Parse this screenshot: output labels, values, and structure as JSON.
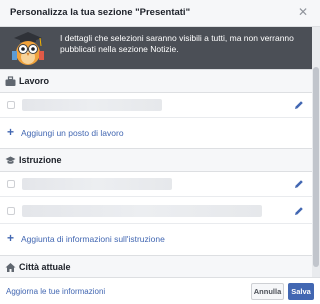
{
  "dialog": {
    "title": "Personalizza la tua sezione \"Presentati\"",
    "close_icon": "close-icon"
  },
  "banner": {
    "icon": "owl-mascot-icon",
    "text": "I dettagli che selezioni saranno visibili a tutti, ma non verranno pubblicati nella sezione Notizie."
  },
  "sections": {
    "work": {
      "icon": "briefcase-icon",
      "label": "Lavoro",
      "add_link": "Aggiungi un posto di lavoro"
    },
    "education": {
      "icon": "graduation-cap-icon",
      "label": "Istruzione",
      "add_link": "Aggiunta di informazioni sull'istruzione"
    },
    "city": {
      "icon": "home-icon",
      "label": "Città attuale"
    }
  },
  "footer": {
    "update_link": "Aggiorna le tue informazioni",
    "cancel_label": "Annulla",
    "save_label": "Salva"
  },
  "colors": {
    "accent": "#4267b2",
    "banner_bg": "#4b4f56",
    "header_bg": "#f6f7f9"
  }
}
